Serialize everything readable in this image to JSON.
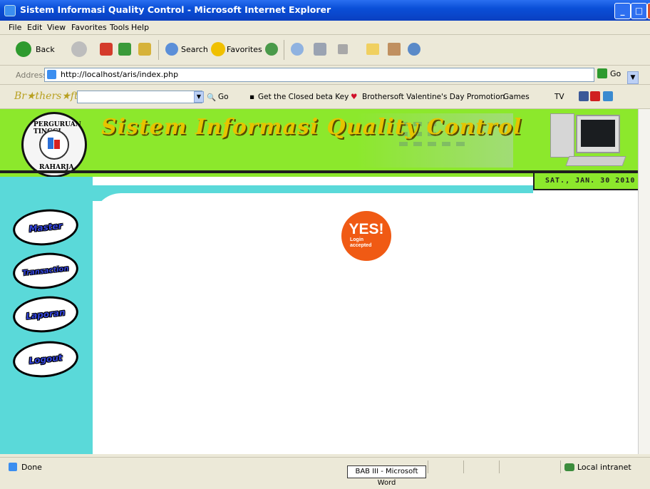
{
  "window": {
    "title": "Sistem Informasi Quality Control - Microsoft Internet Explorer",
    "controls": [
      "minimize",
      "maximize",
      "close"
    ]
  },
  "menu": [
    "File",
    "Edit",
    "View",
    "Favorites",
    "Tools",
    "Help"
  ],
  "toolbar": {
    "back": "Back",
    "search": "Search",
    "favorites": "Favorites"
  },
  "address": {
    "label": "Address",
    "url": "http://localhost/aris/index.php",
    "go": "Go"
  },
  "brothersoft": {
    "logo": "Br★thers★ft",
    "go": "Go",
    "beta": "Get the Closed beta Key",
    "promo": "Brothersoft Valentine's Day Promotion",
    "games": "Games",
    "tv": "TV"
  },
  "header": {
    "title": "Sistem Informasi Quality Control",
    "seal_top": "PERGURUAN TINGGI",
    "seal_bottom": "RAHARJA",
    "date": "SAT., JAN. 30 2010",
    "bg_color": "#8ce82c",
    "title_color": "#e6c400"
  },
  "nav": [
    {
      "label": "Master"
    },
    {
      "label": "Transaction"
    },
    {
      "label": "Laporan"
    },
    {
      "label": "Logout"
    }
  ],
  "badge": {
    "big": "YES!",
    "line1": "Login",
    "line2": "accepted",
    "color": "#f05a14"
  },
  "sidebar_color": "#5ad9d9",
  "status": {
    "done": "Done",
    "taskbar_item": "BAB III - Microsoft Word",
    "zone": "Local intranet"
  }
}
